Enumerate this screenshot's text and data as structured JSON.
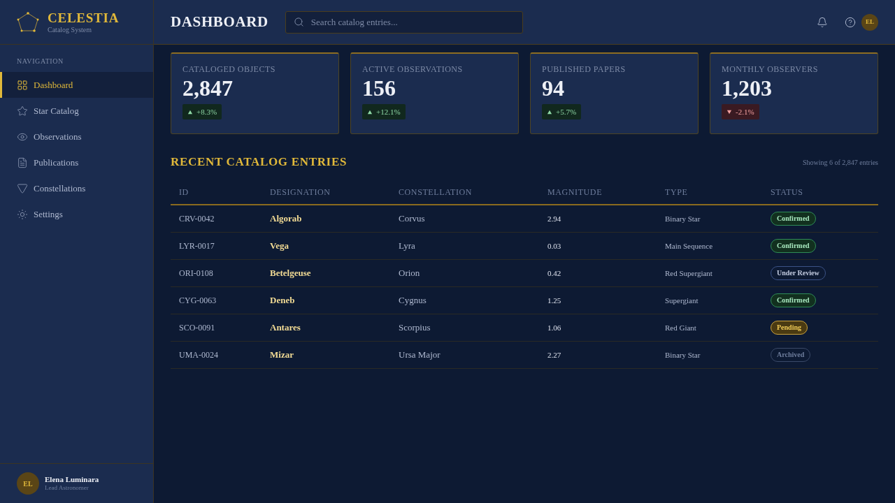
{
  "sidebar": {
    "brand": {
      "name": "CELESTIA",
      "tagline": "Catalog System"
    },
    "section_label": "NAVIGATION",
    "items": [
      {
        "label": "Dashboard",
        "selected": true
      },
      {
        "label": "Star Catalog",
        "selected": false
      },
      {
        "label": "Observations",
        "selected": false
      },
      {
        "label": "Publications",
        "selected": false
      },
      {
        "label": "Constellations",
        "selected": false
      },
      {
        "label": "Settings",
        "selected": false
      }
    ],
    "user": {
      "initials": "EL",
      "name": "Elena Luminara",
      "role": "Lead Astronomer"
    }
  },
  "header": {
    "title": "DASHBOARD",
    "search": {
      "placeholder": "Search catalog entries..."
    },
    "avatar": {
      "initials": "EL"
    }
  },
  "stats": [
    {
      "label": "CATALOGED OBJECTS",
      "value": "2,847",
      "change": "+8.3%",
      "kind": "up"
    },
    {
      "label": "ACTIVE OBSERVATIONS",
      "value": "156",
      "change": "+12.1%",
      "kind": "up"
    },
    {
      "label": "PUBLISHED PAPERS",
      "value": "94",
      "change": "+5.7%",
      "kind": "up"
    },
    {
      "label": "MONTHLY OBSERVERS",
      "value": "1,203",
      "change": "-2.1%",
      "kind": "down"
    }
  ],
  "table": {
    "title": "RECENT CATALOG ENTRIES",
    "summary": "Showing 6 of 2,847 entries",
    "columns": [
      "ID",
      "DESIGNATION",
      "CONSTELLATION",
      "MAGNITUDE",
      "TYPE",
      "STATUS"
    ],
    "rows": [
      {
        "id": "CRV-0042",
        "designation": "Algorab",
        "constellation": "Corvus",
        "magnitude": "2.94",
        "type": "Binary Star",
        "status": {
          "label": "Confirmed",
          "kind": "confirmed"
        }
      },
      {
        "id": "LYR-0017",
        "designation": "Vega",
        "constellation": "Lyra",
        "magnitude": "0.03",
        "type": "Main Sequence",
        "status": {
          "label": "Confirmed",
          "kind": "confirmed"
        }
      },
      {
        "id": "ORI-0108",
        "designation": "Betelgeuse",
        "constellation": "Orion",
        "magnitude": "0.42",
        "type": "Red Supergiant",
        "status": {
          "label": "Under Review",
          "kind": "review"
        }
      },
      {
        "id": "CYG-0063",
        "designation": "Deneb",
        "constellation": "Cygnus",
        "magnitude": "1.25",
        "type": "Supergiant",
        "status": {
          "label": "Confirmed",
          "kind": "confirmed"
        }
      },
      {
        "id": "SCO-0091",
        "designation": "Antares",
        "constellation": "Scorpius",
        "magnitude": "1.06",
        "type": "Red Giant",
        "status": {
          "label": "Pending",
          "kind": "pending"
        }
      },
      {
        "id": "UMA-0024",
        "designation": "Mizar",
        "constellation": "Ursa Major",
        "magnitude": "2.27",
        "type": "Binary Star",
        "status": {
          "label": "Archived",
          "kind": "archived"
        }
      }
    ]
  }
}
